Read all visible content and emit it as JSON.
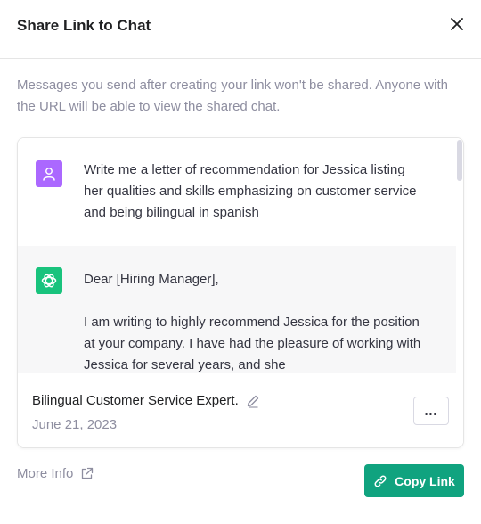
{
  "dialog": {
    "title": "Share Link to Chat",
    "notice": "Messages you send after creating your link won't be shared. Anyone with the URL will be able to view the shared chat."
  },
  "conversation": {
    "user_message": "Write me a letter of recommendation for Jessica listing her qualities and skills emphasizing on customer service and being bilingual in spanish",
    "assistant_paragraphs": [
      "Dear [Hiring Manager],",
      "I am writing to highly recommend Jessica for the position at your company. I have had the pleasure of working with Jessica for several years, and she"
    ]
  },
  "chat_info": {
    "title": "Bilingual Customer Service Expert.",
    "date": "June 21, 2023",
    "more_label": "..."
  },
  "actions": {
    "more_info_label": "More Info",
    "copy_link_label": "Copy Link"
  },
  "colors": {
    "accent": "#10a37f",
    "user_avatar": "#ab68ff",
    "assistant_avatar": "#19c37d"
  },
  "icons": [
    "close-icon",
    "user-icon",
    "openai-logo-icon",
    "pencil-icon",
    "external-link-icon",
    "link-icon"
  ]
}
